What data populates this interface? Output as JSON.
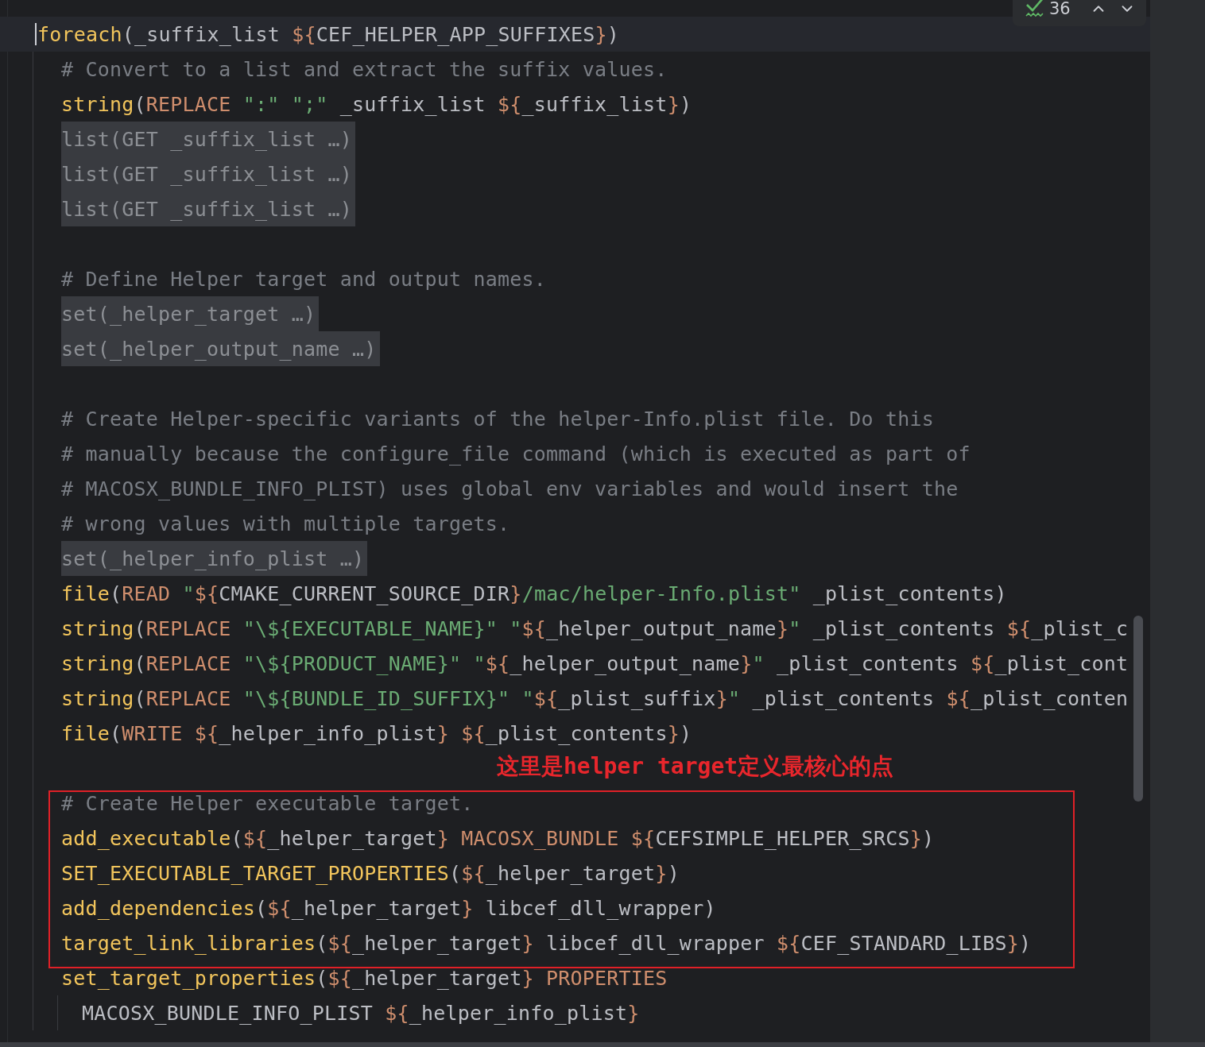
{
  "inspection_widget": {
    "count": "36"
  },
  "lines": [
    {
      "kind": "code",
      "current": true,
      "tokens": [
        {
          "kind": "fn",
          "text": "foreach"
        },
        {
          "kind": "p",
          "text": "(_suffix_list "
        },
        {
          "kind": "v",
          "text": "${"
        },
        {
          "kind": "p",
          "text": "CEF_HELPER_APP_SUFFIXES"
        },
        {
          "kind": "v",
          "text": "}"
        },
        {
          "kind": "p",
          "text": ")"
        }
      ],
      "children": [
        {
          "kind": "comment",
          "text": "# Convert to a list and extract the suffix values."
        },
        {
          "kind": "code",
          "tokens": [
            {
              "kind": "fn",
              "text": "string"
            },
            {
              "kind": "p",
              "text": "("
            },
            {
              "kind": "a",
              "text": "REPLACE "
            },
            {
              "kind": "s",
              "text": "\":\" \";\""
            },
            {
              "kind": "p",
              "text": " _suffix_list "
            },
            {
              "kind": "v",
              "text": "${"
            },
            {
              "kind": "p",
              "text": "_suffix_list"
            },
            {
              "kind": "v",
              "text": "}"
            },
            {
              "kind": "p",
              "text": ")"
            }
          ]
        },
        {
          "kind": "folded",
          "text": "list(GET _suffix_list …)"
        },
        {
          "kind": "folded",
          "text": "list(GET _suffix_list …)"
        },
        {
          "kind": "folded",
          "text": "list(GET _suffix_list …)"
        },
        {
          "kind": "blank"
        },
        {
          "kind": "comment",
          "text": "# Define Helper target and output names."
        },
        {
          "kind": "folded",
          "text": "set(_helper_target …)"
        },
        {
          "kind": "folded",
          "text": "set(_helper_output_name …)"
        },
        {
          "kind": "blank"
        },
        {
          "kind": "comment",
          "text": "# Create Helper-specific variants of the helper-Info.plist file. Do this"
        },
        {
          "kind": "comment",
          "text": "# manually because the configure_file command (which is executed as part of"
        },
        {
          "kind": "comment",
          "text": "# MACOSX_BUNDLE_INFO_PLIST) uses global env variables and would insert the"
        },
        {
          "kind": "comment",
          "text": "# wrong values with multiple targets."
        },
        {
          "kind": "folded",
          "text": "set(_helper_info_plist …)"
        },
        {
          "kind": "code",
          "tokens": [
            {
              "kind": "fn",
              "text": "file"
            },
            {
              "kind": "p",
              "text": "("
            },
            {
              "kind": "a",
              "text": "READ "
            },
            {
              "kind": "s",
              "text": "\""
            },
            {
              "kind": "v",
              "text": "${"
            },
            {
              "kind": "p",
              "text": "CMAKE_CURRENT_SOURCE_DIR"
            },
            {
              "kind": "v",
              "text": "}"
            },
            {
              "kind": "s",
              "text": "/mac/helper-Info.plist\""
            },
            {
              "kind": "p",
              "text": " _plist_contents)"
            }
          ]
        },
        {
          "kind": "code",
          "tokens": [
            {
              "kind": "fn",
              "text": "string"
            },
            {
              "kind": "p",
              "text": "("
            },
            {
              "kind": "a",
              "text": "REPLACE "
            },
            {
              "kind": "s",
              "text": "\"\\${EXECUTABLE_NAME}\" \""
            },
            {
              "kind": "v",
              "text": "${"
            },
            {
              "kind": "p",
              "text": "_helper_output_name"
            },
            {
              "kind": "v",
              "text": "}"
            },
            {
              "kind": "s",
              "text": "\""
            },
            {
              "kind": "p",
              "text": " _plist_contents "
            },
            {
              "kind": "v",
              "text": "${"
            },
            {
              "kind": "p",
              "text": "_plist_c"
            }
          ]
        },
        {
          "kind": "code",
          "tokens": [
            {
              "kind": "fn",
              "text": "string"
            },
            {
              "kind": "p",
              "text": "("
            },
            {
              "kind": "a",
              "text": "REPLACE "
            },
            {
              "kind": "s",
              "text": "\"\\${PRODUCT_NAME}\" \""
            },
            {
              "kind": "v",
              "text": "${"
            },
            {
              "kind": "p",
              "text": "_helper_output_name"
            },
            {
              "kind": "v",
              "text": "}"
            },
            {
              "kind": "s",
              "text": "\""
            },
            {
              "kind": "p",
              "text": " _plist_contents "
            },
            {
              "kind": "v",
              "text": "${"
            },
            {
              "kind": "p",
              "text": "_plist_cont"
            }
          ]
        },
        {
          "kind": "code",
          "tokens": [
            {
              "kind": "fn",
              "text": "string"
            },
            {
              "kind": "p",
              "text": "("
            },
            {
              "kind": "a",
              "text": "REPLACE "
            },
            {
              "kind": "s",
              "text": "\"\\${BUNDLE_ID_SUFFIX}\" \""
            },
            {
              "kind": "v",
              "text": "${"
            },
            {
              "kind": "p",
              "text": "_plist_suffix"
            },
            {
              "kind": "v",
              "text": "}"
            },
            {
              "kind": "s",
              "text": "\""
            },
            {
              "kind": "p",
              "text": " _plist_contents "
            },
            {
              "kind": "v",
              "text": "${"
            },
            {
              "kind": "p",
              "text": "_plist_conten"
            }
          ]
        },
        {
          "kind": "code",
          "tokens": [
            {
              "kind": "fn",
              "text": "file"
            },
            {
              "kind": "p",
              "text": "("
            },
            {
              "kind": "a",
              "text": "WRITE "
            },
            {
              "kind": "v",
              "text": "${"
            },
            {
              "kind": "p",
              "text": "_helper_info_plist"
            },
            {
              "kind": "v",
              "text": "} ${"
            },
            {
              "kind": "p",
              "text": "_plist_contents"
            },
            {
              "kind": "v",
              "text": "}"
            },
            {
              "kind": "p",
              "text": ")"
            }
          ]
        },
        {
          "kind": "blank"
        },
        {
          "kind": "comment",
          "text": "# Create Helper executable target."
        },
        {
          "kind": "code",
          "tokens": [
            {
              "kind": "fn",
              "text": "add_executable"
            },
            {
              "kind": "p",
              "text": "("
            },
            {
              "kind": "v",
              "text": "${"
            },
            {
              "kind": "p",
              "text": "_helper_target"
            },
            {
              "kind": "v",
              "text": "} MACOSX_BUNDLE ${"
            },
            {
              "kind": "p",
              "text": "CEFSIMPLE_HELPER_SRCS"
            },
            {
              "kind": "v",
              "text": "}"
            },
            {
              "kind": "p",
              "text": ")"
            }
          ]
        },
        {
          "kind": "code",
          "tokens": [
            {
              "kind": "fn",
              "text": "SET_EXECUTABLE_TARGET_PROPERTIES"
            },
            {
              "kind": "p",
              "text": "("
            },
            {
              "kind": "v",
              "text": "${"
            },
            {
              "kind": "p",
              "text": "_helper_target"
            },
            {
              "kind": "v",
              "text": "}"
            },
            {
              "kind": "p",
              "text": ")"
            }
          ]
        },
        {
          "kind": "code",
          "tokens": [
            {
              "kind": "fn",
              "text": "add_dependencies"
            },
            {
              "kind": "p",
              "text": "("
            },
            {
              "kind": "v",
              "text": "${"
            },
            {
              "kind": "p",
              "text": "_helper_target"
            },
            {
              "kind": "v",
              "text": "}"
            },
            {
              "kind": "p",
              "text": " libcef_dll_wrapper)"
            }
          ]
        },
        {
          "kind": "code",
          "tokens": [
            {
              "kind": "fn",
              "text": "target_link_libraries"
            },
            {
              "kind": "p",
              "text": "("
            },
            {
              "kind": "v",
              "text": "${"
            },
            {
              "kind": "p",
              "text": "_helper_target"
            },
            {
              "kind": "v",
              "text": "}"
            },
            {
              "kind": "p",
              "text": " libcef_dll_wrapper "
            },
            {
              "kind": "v",
              "text": "${"
            },
            {
              "kind": "p",
              "text": "CEF_STANDARD_LIBS"
            },
            {
              "kind": "v",
              "text": "}"
            },
            {
              "kind": "p",
              "text": ")"
            }
          ]
        },
        {
          "kind": "code",
          "tokens": [
            {
              "kind": "fn",
              "text": "set_target_properties"
            },
            {
              "kind": "p",
              "text": "("
            },
            {
              "kind": "v",
              "text": "${"
            },
            {
              "kind": "p",
              "text": "_helper_target"
            },
            {
              "kind": "v",
              "text": "} PROPERTIES"
            }
          ],
          "children": [
            {
              "kind": "code",
              "tokens": [
                {
                  "kind": "p",
                  "text": "MACOSX_BUNDLE_INFO_PLIST "
                },
                {
                  "kind": "v",
                  "text": "${"
                },
                {
                  "kind": "p",
                  "text": "_helper_info_plist"
                },
                {
                  "kind": "v",
                  "text": "}"
                }
              ]
            }
          ]
        }
      ]
    }
  ],
  "annotation": {
    "text": "这里是helper target定义最核心的点"
  }
}
